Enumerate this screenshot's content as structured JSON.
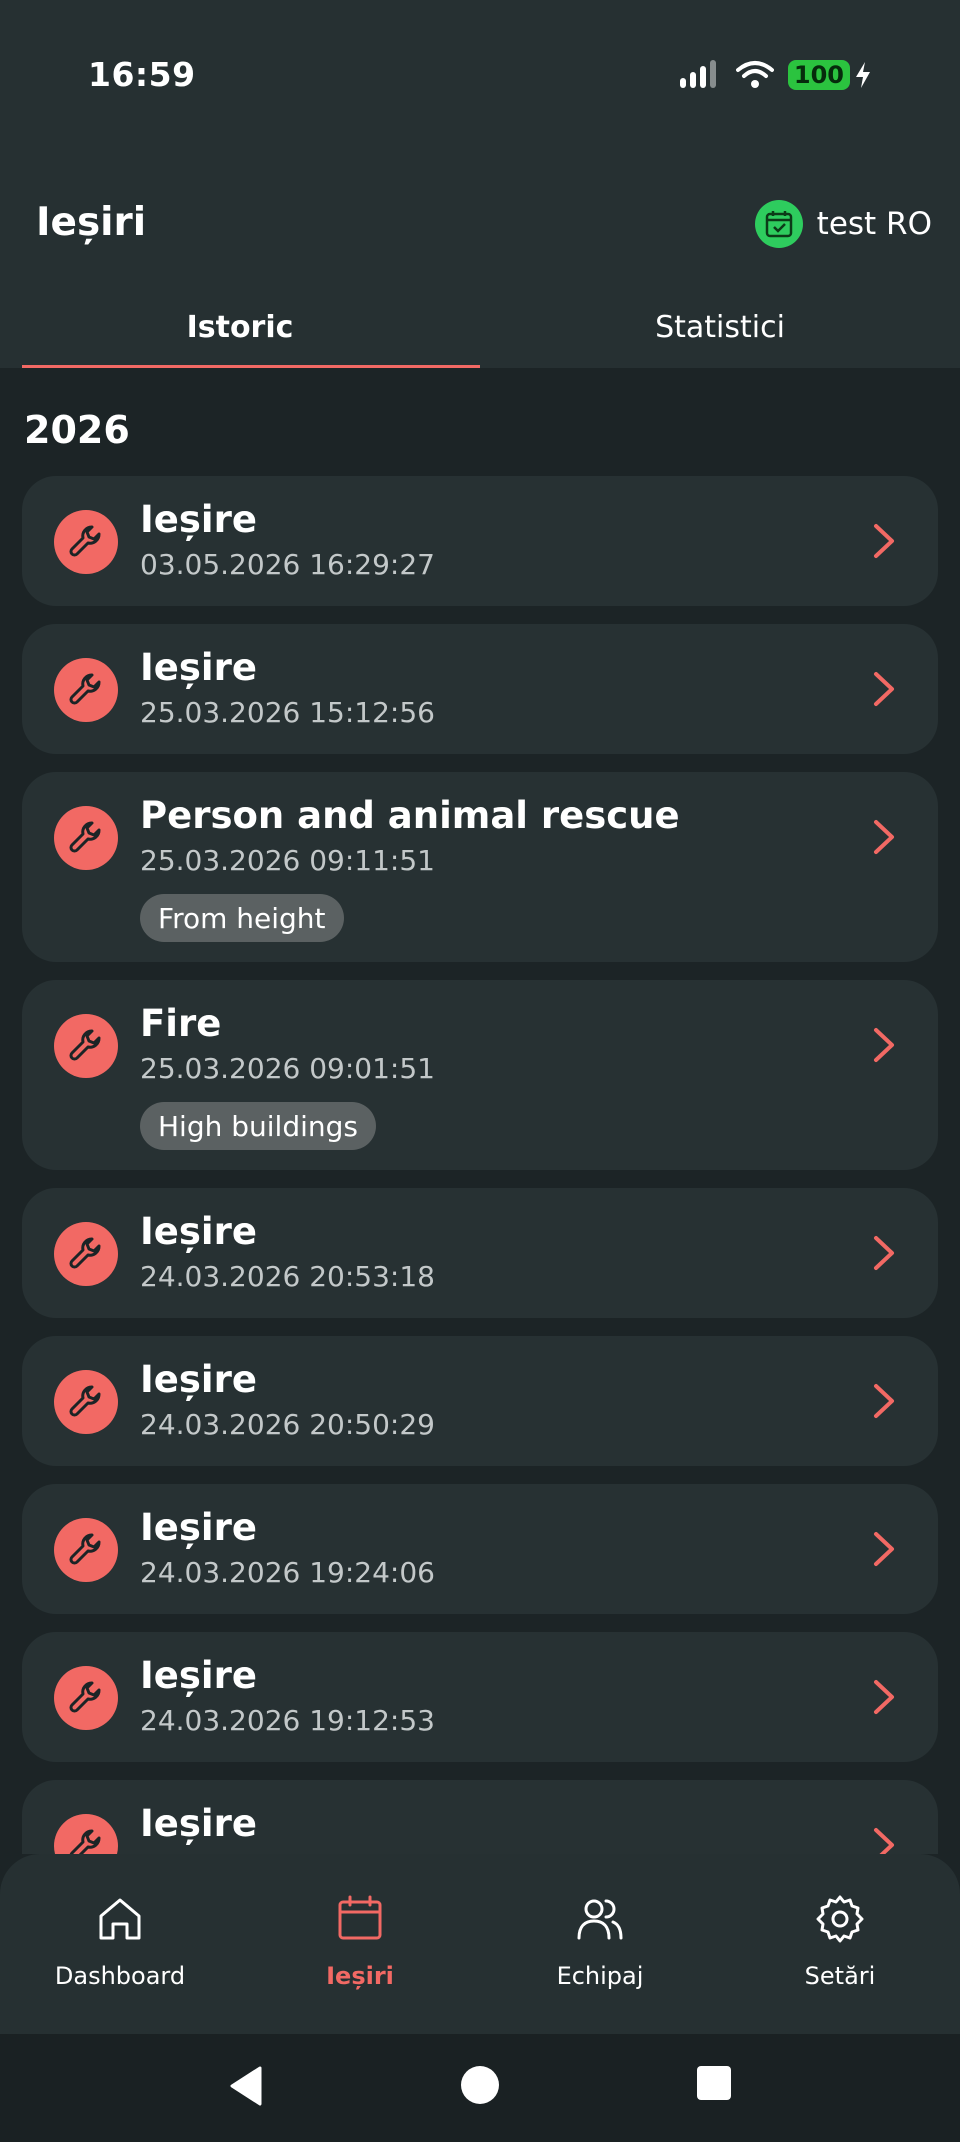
{
  "status_bar": {
    "time": "16:59",
    "battery": "100"
  },
  "header": {
    "title": "Ieșiri",
    "user_name": "test RO"
  },
  "tabs": [
    {
      "label": "Istoric",
      "active": true
    },
    {
      "label": "Statistici",
      "active": false
    }
  ],
  "year": "2026",
  "items": [
    {
      "title": "Ieșire",
      "time": "03.05.2026 16:29:27",
      "tag": ""
    },
    {
      "title": "Ieșire",
      "time": "25.03.2026 15:12:56",
      "tag": ""
    },
    {
      "title": "Person and animal rescue",
      "time": "25.03.2026 09:11:51",
      "tag": "From height"
    },
    {
      "title": "Fire",
      "time": "25.03.2026 09:01:51",
      "tag": "High buildings"
    },
    {
      "title": "Ieșire",
      "time": "24.03.2026 20:53:18",
      "tag": ""
    },
    {
      "title": "Ieșire",
      "time": "24.03.2026 20:50:29",
      "tag": ""
    },
    {
      "title": "Ieșire",
      "time": "24.03.2026 19:24:06",
      "tag": ""
    },
    {
      "title": "Ieșire",
      "time": "24.03.2026 19:12:53",
      "tag": ""
    },
    {
      "title": "Ieșire",
      "time": "",
      "tag": ""
    }
  ],
  "bottom_nav": [
    {
      "label": "Dashboard",
      "icon": "home-icon",
      "active": false
    },
    {
      "label": "Ieșiri",
      "icon": "calendar-icon",
      "active": true
    },
    {
      "label": "Echipaj",
      "icon": "users-icon",
      "active": false
    },
    {
      "label": "Setări",
      "icon": "gear-icon",
      "active": false
    }
  ],
  "colors": {
    "accent": "#f26964",
    "surface": "#273133",
    "background": "#1c2426",
    "success": "#2ecc5e"
  }
}
